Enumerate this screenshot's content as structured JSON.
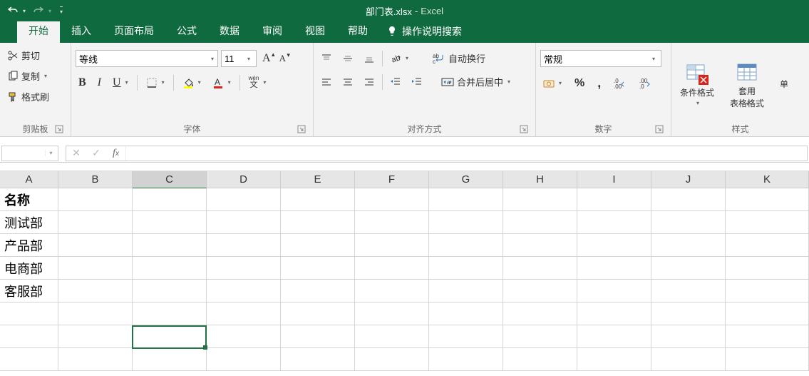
{
  "title": {
    "filename": "部门表.xlsx",
    "sep": " - ",
    "app": "Excel"
  },
  "tabs": {
    "home": "开始",
    "insert": "插入",
    "layout": "页面布局",
    "formula": "公式",
    "data": "数据",
    "review": "审阅",
    "view": "视图",
    "help": "帮助",
    "tell": "操作说明搜索"
  },
  "clipboard": {
    "cut": "剪切",
    "copy": "复制",
    "paint": "格式刷",
    "label": "剪贴板"
  },
  "font": {
    "name": "等线",
    "size": "11",
    "label": "字体",
    "bold": "B",
    "italic": "I",
    "underline": "U",
    "pinyin": "wén"
  },
  "align": {
    "wrap": "自动换行",
    "merge": "合并后居中",
    "label": "对齐方式"
  },
  "number": {
    "format": "常规",
    "label": "数字"
  },
  "styles": {
    "cond": "条件格式",
    "table": "套用\n表格格式",
    "cell": "单",
    "label": "样式"
  },
  "namebox": "",
  "formula": "",
  "columns": [
    "A",
    "B",
    "C",
    "D",
    "E",
    "F",
    "G",
    "H",
    "I",
    "J",
    "K"
  ],
  "cells": {
    "A1": "名称",
    "A2": "测试部",
    "A3": "产品部",
    "A4": "电商部",
    "A5": "客服部"
  },
  "selected_col": "C",
  "chart_data": null
}
